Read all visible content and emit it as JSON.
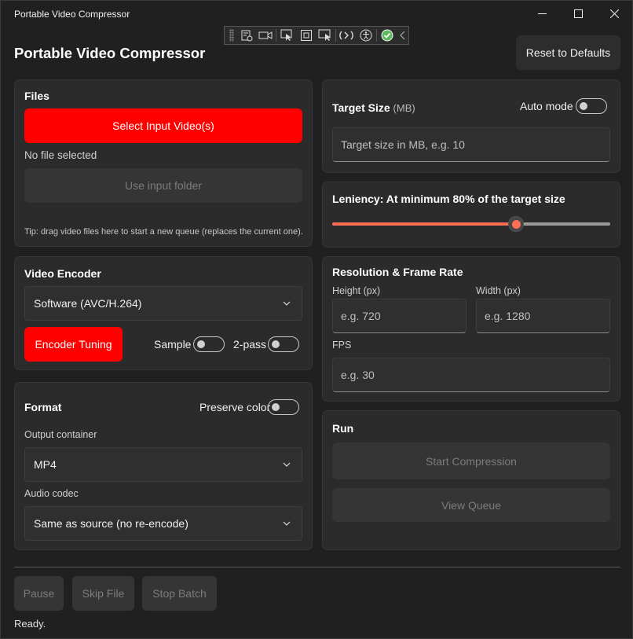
{
  "window": {
    "title": "Portable Video Compressor",
    "icons": [
      "minimize-icon",
      "maximize-icon",
      "close-icon"
    ]
  },
  "debug_toolbar": {
    "icons": [
      "live-tree-icon",
      "video-icon",
      "select-element-icon",
      "track-focus-icon",
      "display-layout-icon",
      "hot-reload-icon",
      "accessibility-icon",
      "checkmark-icon",
      "collapse-chevron-icon"
    ],
    "check_color": "#5cb85c"
  },
  "header": {
    "title": "Portable Video Compressor",
    "reset_label": "Reset to Defaults"
  },
  "files": {
    "heading": "Files",
    "select_label": "Select Input Video(s)",
    "status": "No file selected",
    "folder_label": "Use input folder",
    "tip": "Tip: drag video files here to start a new queue (replaces the current one)."
  },
  "encoder": {
    "heading": "Video Encoder",
    "selected": "Software (AVC/H.264)",
    "tuning_label": "Encoder Tuning",
    "sample_label": "Sample",
    "sample_on": false,
    "twopass_label": "2-pass",
    "twopass_on": false
  },
  "format": {
    "heading": "Format",
    "preserve_label": "Preserve color",
    "preserve_on": false,
    "container_label": "Output container",
    "container_value": "MP4",
    "audio_label": "Audio codec",
    "audio_value": "Same as source (no re-encode)"
  },
  "target": {
    "heading": "Target Size",
    "unit": "(MB)",
    "auto_label": "Auto mode",
    "auto_on": false,
    "placeholder": "Target size in MB, e.g. 10"
  },
  "leniency": {
    "label": "Leniency: At minimum 80% of the target size",
    "value_fraction": 0.66,
    "accent": "#ff6d55"
  },
  "resolution": {
    "heading": "Resolution & Frame Rate",
    "height_label": "Height (px)",
    "height_placeholder": "e.g. 720",
    "width_label": "Width (px)",
    "width_placeholder": "e.g. 1280",
    "fps_label": "FPS",
    "fps_placeholder": "e.g. 30"
  },
  "run": {
    "heading": "Run",
    "start_label": "Start Compression",
    "queue_label": "View Queue"
  },
  "footer": {
    "pause_label": "Pause",
    "skip_label": "Skip File",
    "stop_label": "Stop Batch",
    "status": "Ready."
  },
  "colors": {
    "accent_red": "#ff0000",
    "background": "#202020",
    "card": "#2b2b2b"
  }
}
